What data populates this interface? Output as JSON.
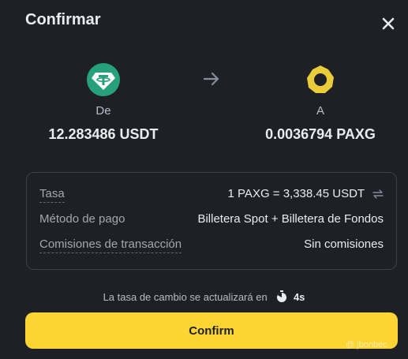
{
  "header": {
    "title": "Confirmar"
  },
  "from": {
    "direction": "De",
    "amount": "12.283486 USDT",
    "icon": "usdt-icon",
    "color": "#26A17B"
  },
  "to": {
    "direction": "A",
    "amount": "0.0036794 PAXG",
    "icon": "paxg-icon",
    "color": "#E8CC3A"
  },
  "details": [
    {
      "label": "Tasa",
      "value": "1 PAXG = 3,338.45 USDT"
    },
    {
      "label": "Método de pago",
      "value": "Billetera Spot + Billetera de Fondos"
    },
    {
      "label": "Comisiones de transacción",
      "value": "Sin comisiones"
    }
  ],
  "refresh": {
    "text": "La tasa de cambio se actualizará en",
    "seconds": "4s"
  },
  "confirm_label": "Confirm",
  "watermark": "@ jbonbec",
  "colors": {
    "background": "#1E2026",
    "accent": "#FCD535",
    "border": "#3A3F47"
  }
}
